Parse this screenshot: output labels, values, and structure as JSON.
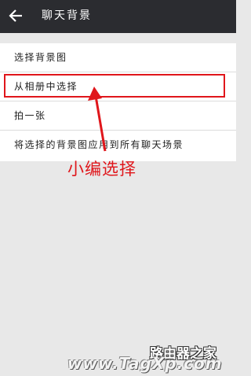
{
  "header": {
    "title": "聊天背景",
    "back_icon": "back-arrow-icon"
  },
  "menu": {
    "items": [
      {
        "label": "选择背景图"
      },
      {
        "label": "从相册中选择"
      },
      {
        "label": "拍一张"
      },
      {
        "label": "将选择的背景图应用到所有聊天场景"
      }
    ]
  },
  "annotation": {
    "text": "小编选择",
    "color": "#e0161b"
  },
  "watermark": {
    "site_name": "路由器之家",
    "url": "www.TagXp.com"
  },
  "colors": {
    "topbar": "#2b2c30",
    "background": "#e8e8e8",
    "accent": "#e0161b"
  }
}
